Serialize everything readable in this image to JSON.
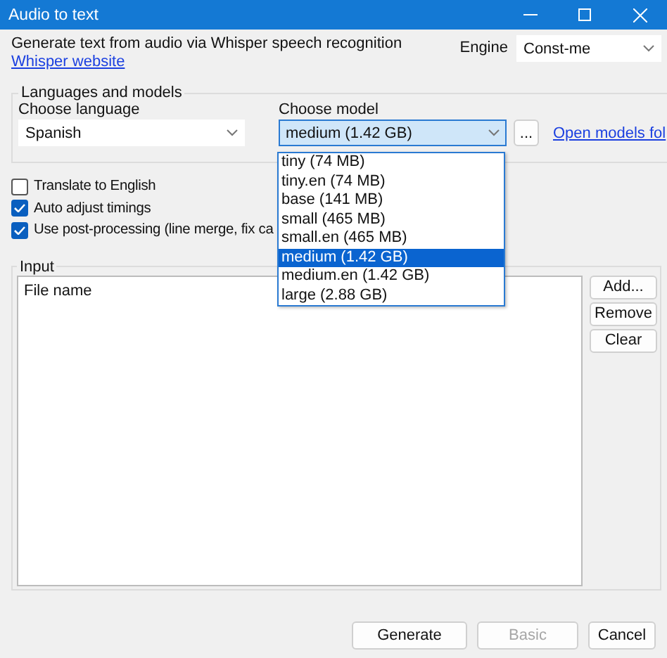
{
  "window": {
    "title": "Audio to text"
  },
  "description": "Generate text from audio via Whisper speech recognition",
  "website_link": "Whisper website",
  "engine": {
    "label": "Engine",
    "value": "Const-me"
  },
  "languages_group": {
    "title": "Languages and models",
    "language": {
      "label": "Choose language",
      "value": "Spanish"
    },
    "model": {
      "label": "Choose model",
      "value": "medium (1.42 GB)",
      "expanded": true,
      "options": [
        {
          "label": "tiny (74 MB)",
          "selected": false
        },
        {
          "label": "tiny.en (74 MB)",
          "selected": false
        },
        {
          "label": "base (141 MB)",
          "selected": false
        },
        {
          "label": "small (465 MB)",
          "selected": false
        },
        {
          "label": "small.en (465 MB)",
          "selected": false
        },
        {
          "label": "medium (1.42 GB)",
          "selected": true
        },
        {
          "label": "medium.en (1.42 GB)",
          "selected": false
        },
        {
          "label": "large (2.88 GB)",
          "selected": false
        }
      ]
    },
    "browse_button": "...",
    "open_folder_link": "Open models fol"
  },
  "options": [
    {
      "label": "Translate to English",
      "checked": false
    },
    {
      "label": "Auto adjust timings",
      "checked": true
    },
    {
      "label": "Use post-processing (line merge, fix ca",
      "checked": true
    }
  ],
  "input_group": {
    "title": "Input",
    "columns": [
      "File name"
    ],
    "buttons": [
      "Add...",
      "Remove",
      "Clear"
    ]
  },
  "footer_buttons": [
    {
      "label": "Generate",
      "disabled": false
    },
    {
      "label": "Basic",
      "disabled": true
    },
    {
      "label": "Cancel",
      "disabled": false
    }
  ]
}
